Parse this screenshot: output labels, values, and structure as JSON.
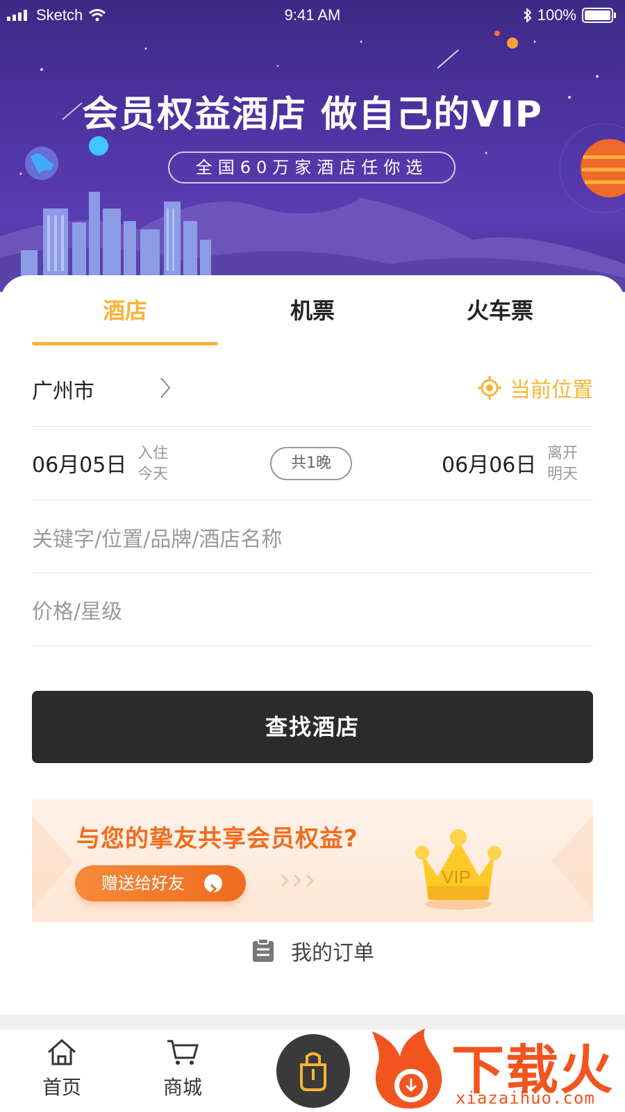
{
  "status_bar": {
    "carrier": "Sketch",
    "time": "9:41 AM",
    "battery": "100%"
  },
  "hero": {
    "title": "会员权益酒店 做自己的VIP",
    "subtitle": "全国60万家酒店任你选"
  },
  "tabs": [
    {
      "label": "酒店",
      "active": true
    },
    {
      "label": "机票",
      "active": false
    },
    {
      "label": "火车票",
      "active": false
    }
  ],
  "location": {
    "city": "广州市",
    "current_location_label": "当前位置",
    "icon": "locate-icon"
  },
  "dates": {
    "checkin_date": "06月05日",
    "checkin_label": "入住",
    "checkin_day": "今天",
    "nights": "共1晚",
    "checkout_date": "06月06日",
    "checkout_label": "离开",
    "checkout_day": "明天"
  },
  "fields": {
    "keyword_placeholder": "关键字/位置/品牌/酒店名称",
    "price_placeholder": "价格/星级"
  },
  "search_button": "查找酒店",
  "promo": {
    "title": "与您的挚友共享会员权益?",
    "button": "赠送给好友",
    "badge": "VIP"
  },
  "orders": {
    "label": "我的订单",
    "icon": "clipboard-icon"
  },
  "tabbar": [
    {
      "label": "首页",
      "icon": "home-icon"
    },
    {
      "label": "商城",
      "icon": "cart-icon"
    },
    {
      "label": "",
      "icon": "bag-icon"
    }
  ],
  "watermark": {
    "text": "下载火",
    "url": "xiazaihuo.com"
  },
  "colors": {
    "accent": "#f7b434",
    "hero_bg": "#4e35a3",
    "button_dark": "#2b2b2b",
    "promo_orange": "#f26b1d"
  }
}
